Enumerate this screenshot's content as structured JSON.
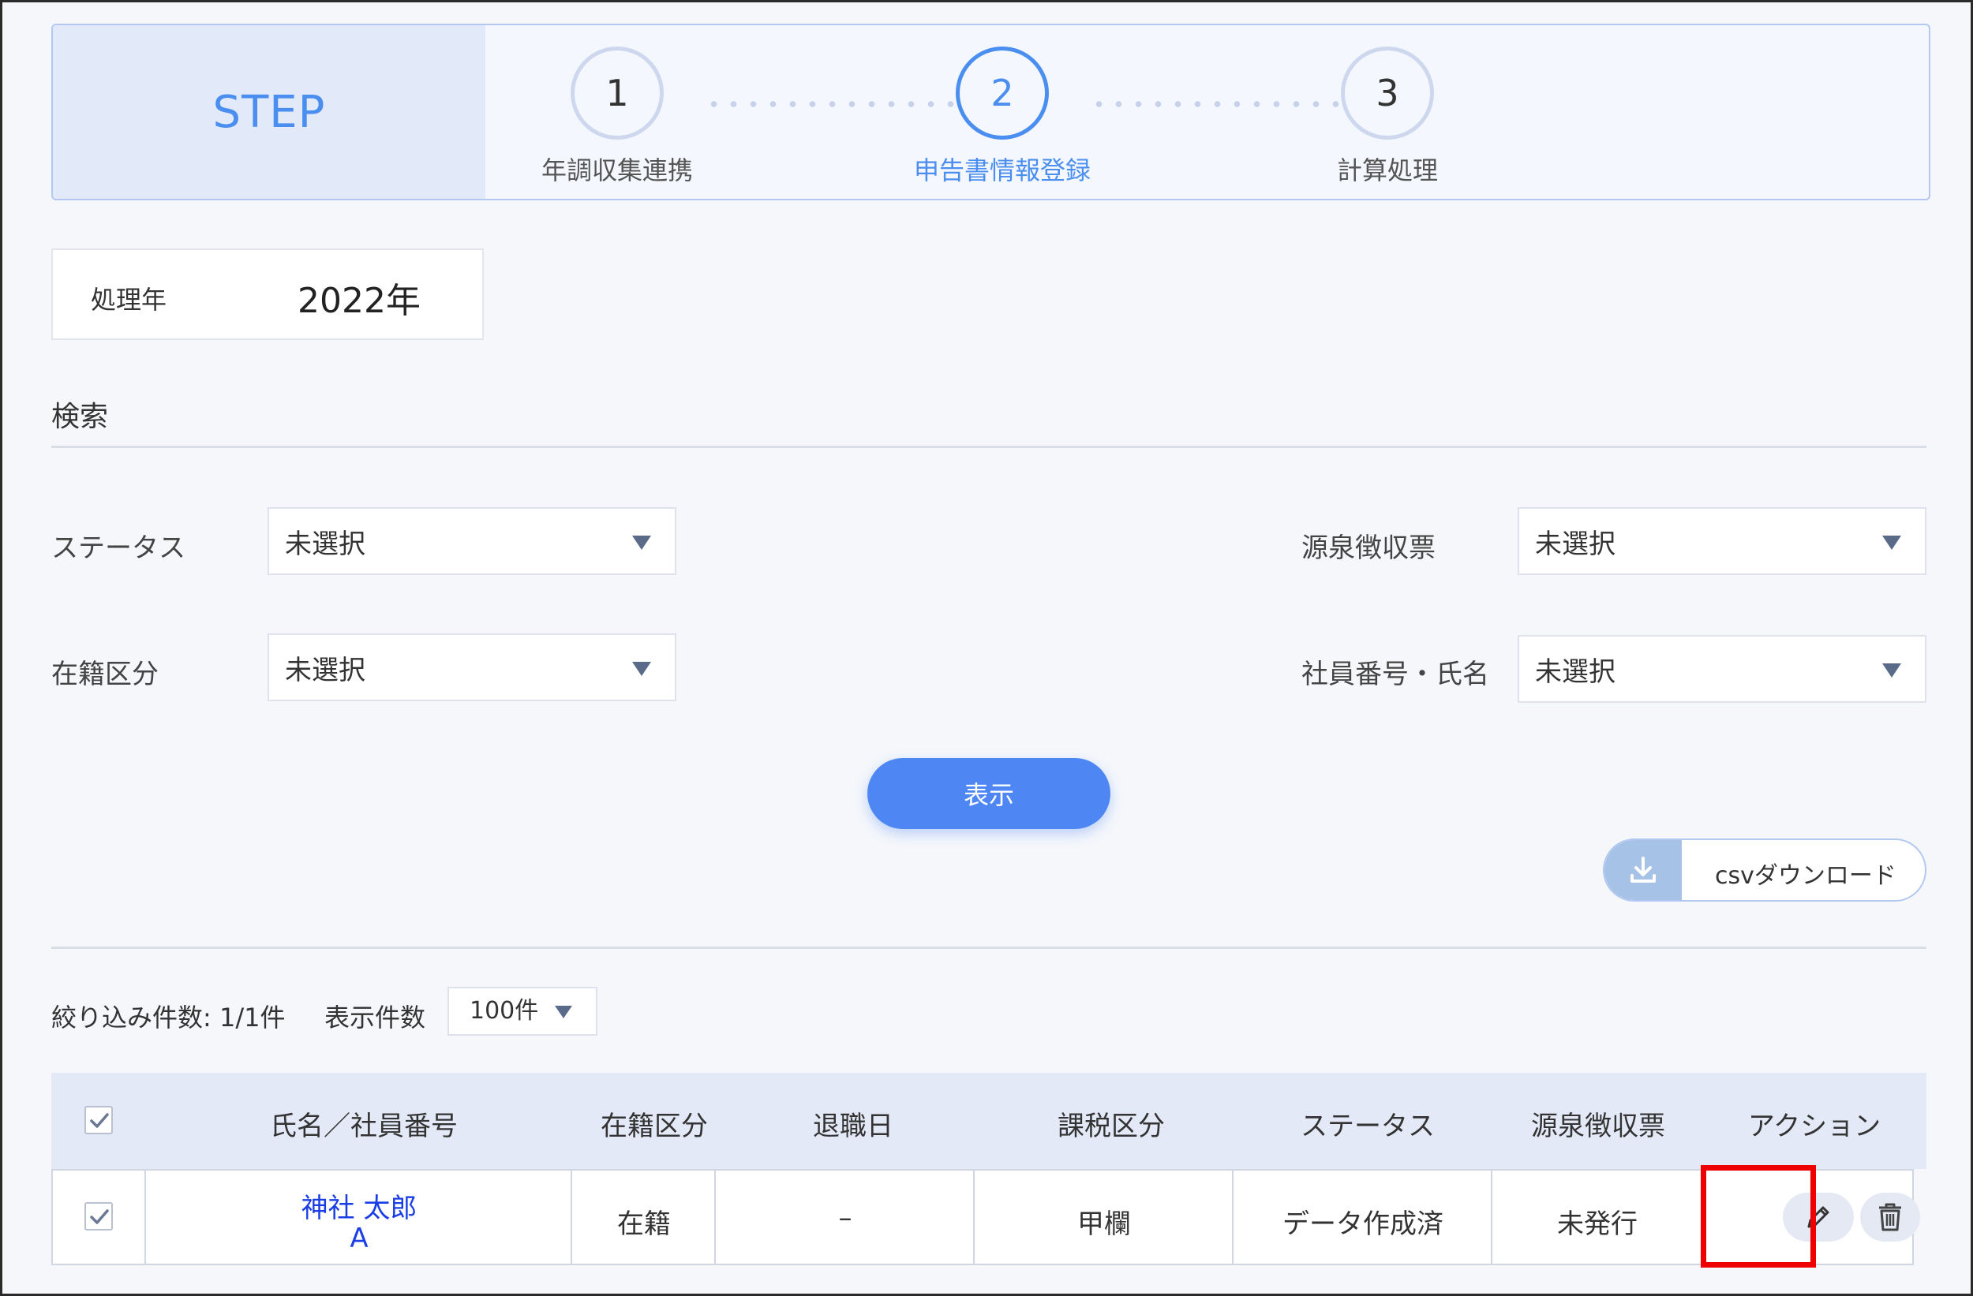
{
  "steps": {
    "label": "STEP",
    "items": [
      {
        "number": "1",
        "caption": "年調収集連携",
        "active": false
      },
      {
        "number": "2",
        "caption": "申告書情報登録",
        "active": true
      },
      {
        "number": "3",
        "caption": "計算処理",
        "active": false
      }
    ]
  },
  "year": {
    "label": "処理年",
    "value": "2022年"
  },
  "search": {
    "title": "検索",
    "fields": {
      "status": {
        "label": "ステータス",
        "value": "未選択"
      },
      "withholding": {
        "label": "源泉徴収票",
        "value": "未選択"
      },
      "enrollment": {
        "label": "在籍区分",
        "value": "未選択"
      },
      "employee": {
        "label": "社員番号・氏名",
        "value": "未選択"
      }
    },
    "show_button": "表示"
  },
  "csv_button": "csvダウンロード",
  "list": {
    "count_text": "絞り込み件数: 1/1件",
    "per_page_label": "表示件数",
    "per_page_value": "100件"
  },
  "table": {
    "headers": {
      "name": "氏名／社員番号",
      "enrollment": "在籍区分",
      "retire_date": "退職日",
      "tax_class": "課税区分",
      "status": "ステータス",
      "withholding": "源泉徴収票",
      "action": "アクション"
    },
    "rows": [
      {
        "name": "神社 太郎",
        "employee_no": "A",
        "enrollment": "在籍",
        "retire_date": "–",
        "tax_class": "甲欄",
        "status": "データ作成済",
        "withholding": "未発行",
        "checked": true
      }
    ]
  },
  "icons": {
    "download": "download-icon",
    "edit": "pencil-icon",
    "delete": "trash-icon",
    "dropdown": "caret-down-icon"
  },
  "colors": {
    "accent": "#4a8ef0",
    "button": "#4e87f3",
    "link": "#1a3ee6",
    "highlight": "#ee0000"
  }
}
